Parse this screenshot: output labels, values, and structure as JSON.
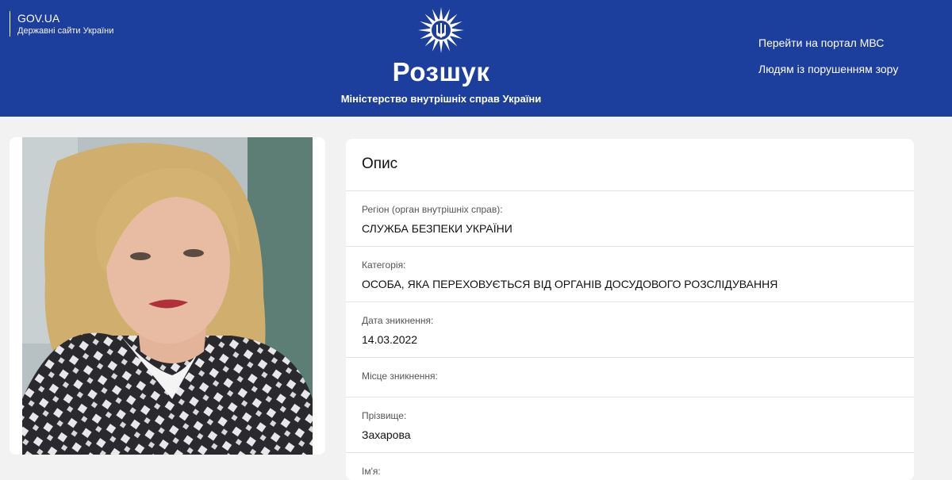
{
  "header": {
    "gov_title": "GOV.UA",
    "gov_subtitle": "Державні сайти України",
    "site_title": "Розшук",
    "site_subtitle": "Міністерство внутрішніх справ України",
    "nav": {
      "portal": "Перейти на портал МВС",
      "vision": "Людям із порушенням зору"
    },
    "emblem_icon": "police-star-emblem-icon",
    "brand_color": "#1c3e9c"
  },
  "photo": {
    "icon": "wanted-person-photo"
  },
  "description": {
    "title": "Опис",
    "fields": [
      {
        "label": "Регіон (орган внутрішніх справ):",
        "value": "СЛУЖБА БЕЗПЕКИ УКРАЇНИ"
      },
      {
        "label": "Категорія:",
        "value": "ОСОБА, ЯКА ПЕРЕХОВУЄТЬСЯ ВІД ОРГАНІВ ДОСУДОВОГО РОЗСЛІДУВАННЯ"
      },
      {
        "label": "Дата зникнення:",
        "value": "14.03.2022"
      },
      {
        "label": "Місце зникнення:",
        "value": ""
      },
      {
        "label": "Прізвище:",
        "value": "Захарова"
      },
      {
        "label": "Ім'я:",
        "value": ""
      }
    ]
  }
}
